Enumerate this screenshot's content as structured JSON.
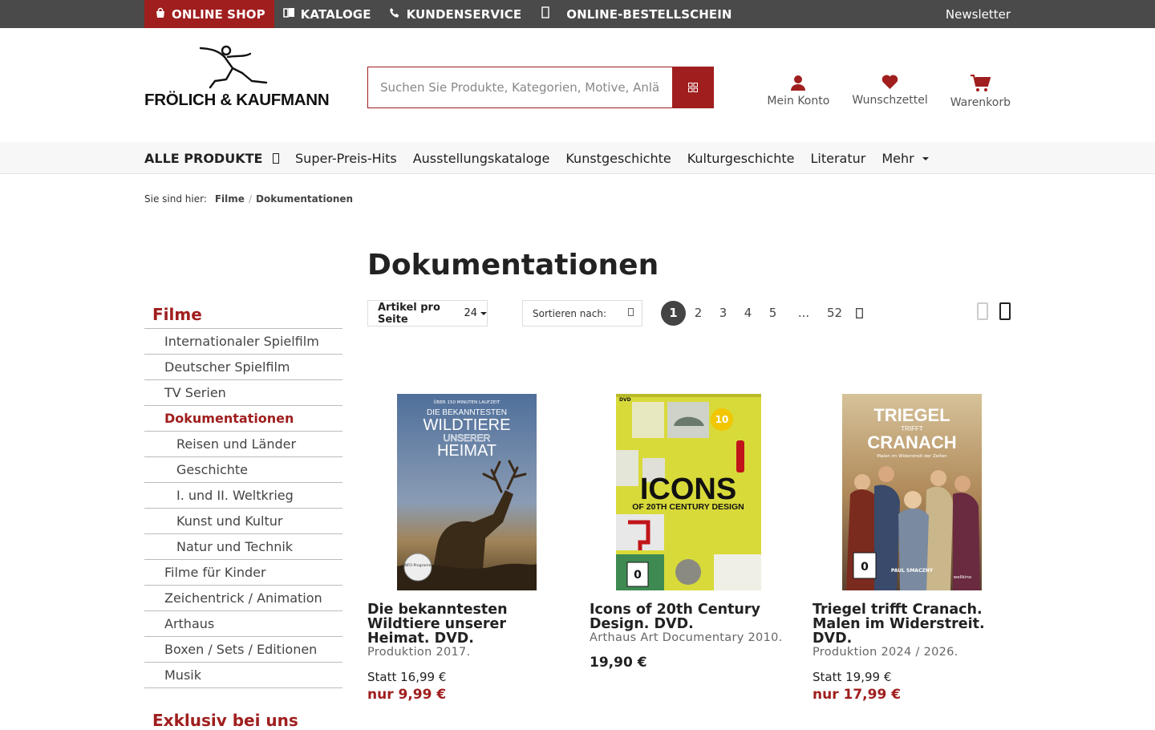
{
  "topbar": {
    "items": [
      {
        "label": "ONLINE SHOP",
        "icon": "shopping-bag-icon"
      },
      {
        "label": "KATALOGE",
        "icon": "book-icon"
      },
      {
        "label": "KUNDENSERVICE",
        "icon": "phone-icon"
      },
      {
        "label": "ONLINE-BESTELLSCHEIN",
        "icon": "form-icon"
      }
    ],
    "newsletter": "Newsletter"
  },
  "header": {
    "brand": "FRÖLICH & KAUFMANN",
    "search_placeholder": "Suchen Sie Produkte, Kategorien, Motive, Anlässe",
    "icons": [
      {
        "label": "Mein Konto",
        "icon": "user-icon"
      },
      {
        "label": "Wunschzettel",
        "icon": "heart-icon"
      },
      {
        "label": "Warenkorb",
        "icon": "cart-icon"
      }
    ]
  },
  "mainnav": {
    "items": [
      "ALLE PRODUKTE",
      "Super-Preis-Hits",
      "Ausstellungskataloge",
      "Kunstgeschichte",
      "Kulturgeschichte",
      "Literatur",
      "Mehr"
    ]
  },
  "breadcrumb": {
    "label": "Sie sind hier:",
    "items": [
      "Filme",
      "Dokumentationen"
    ]
  },
  "sidebar": {
    "title": "Filme",
    "items": [
      {
        "label": "Internationaler Spielfilm",
        "level": 1
      },
      {
        "label": "Deutscher Spielfilm",
        "level": 1
      },
      {
        "label": "TV Serien",
        "level": 1
      },
      {
        "label": "Dokumentationen",
        "level": 1,
        "active": true
      },
      {
        "label": "Reisen und Länder",
        "level": 2
      },
      {
        "label": "Geschichte",
        "level": 2
      },
      {
        "label": "I. und II. Weltkrieg",
        "level": 2
      },
      {
        "label": "Kunst und Kultur",
        "level": 2
      },
      {
        "label": "Natur und Technik",
        "level": 2
      },
      {
        "label": "Filme für Kinder",
        "level": 1
      },
      {
        "label": "Zeichentrick / Animation",
        "level": 1
      },
      {
        "label": "Arthaus",
        "level": 1
      },
      {
        "label": "Boxen / Sets / Editionen",
        "level": 1
      },
      {
        "label": "Musik",
        "level": 1
      }
    ],
    "title2": "Exklusiv bei uns"
  },
  "page": {
    "title": "Dokumentationen",
    "perpage_label": "Artikel pro Seite",
    "perpage_value": "24",
    "sort_label": "Sortieren nach:",
    "pages": [
      "1",
      "2",
      "3",
      "4",
      "5",
      "...",
      "52"
    ],
    "current_page": "1"
  },
  "products": [
    {
      "title": "Die bekanntesten Wildtiere unserer Heimat. DVD.",
      "subtitle": "Produktion 2017.",
      "old_price": "Statt 16,99 €",
      "price": "nur 9,99 €",
      "cover": {
        "top": "ÜBER 150 MINUTEN LAUFZEIT",
        "line1": "DIE BEKANNTESTEN",
        "line2": "WILDTIERE",
        "line3": "UNSERER",
        "line4": "HEIMAT",
        "badge": "INFO-Programm"
      }
    },
    {
      "title": "Icons of 20th Century Design. DVD.",
      "subtitle": "Arthaus Art Documentary 2010.",
      "price": "19,90 €",
      "cover": {
        "dvd": "DVD",
        "big": "ICONS",
        "small": "OF 20TH CENTURY DESIGN",
        "anniv": "10",
        "fsk": "0"
      }
    },
    {
      "title": "Triegel trifft Cranach. Malen im Widerstreit. DVD.",
      "subtitle": "Produktion 2024 / 2026.",
      "old_price": "Statt 19,99 €",
      "price": "nur 17,99 €",
      "cover": {
        "line1": "TRIEGEL",
        "line2": "TRIFFT",
        "line3": "CRANACH",
        "tag": "Malen im Widerstreit der Zeiten",
        "credit": "PAUL SMACZNY",
        "fsk": "0",
        "label": "wellkino"
      }
    }
  ],
  "colors": {
    "accent": "#a01e1e",
    "topbar": "#4a4a4a",
    "nav_bg": "#f7f7f7"
  }
}
